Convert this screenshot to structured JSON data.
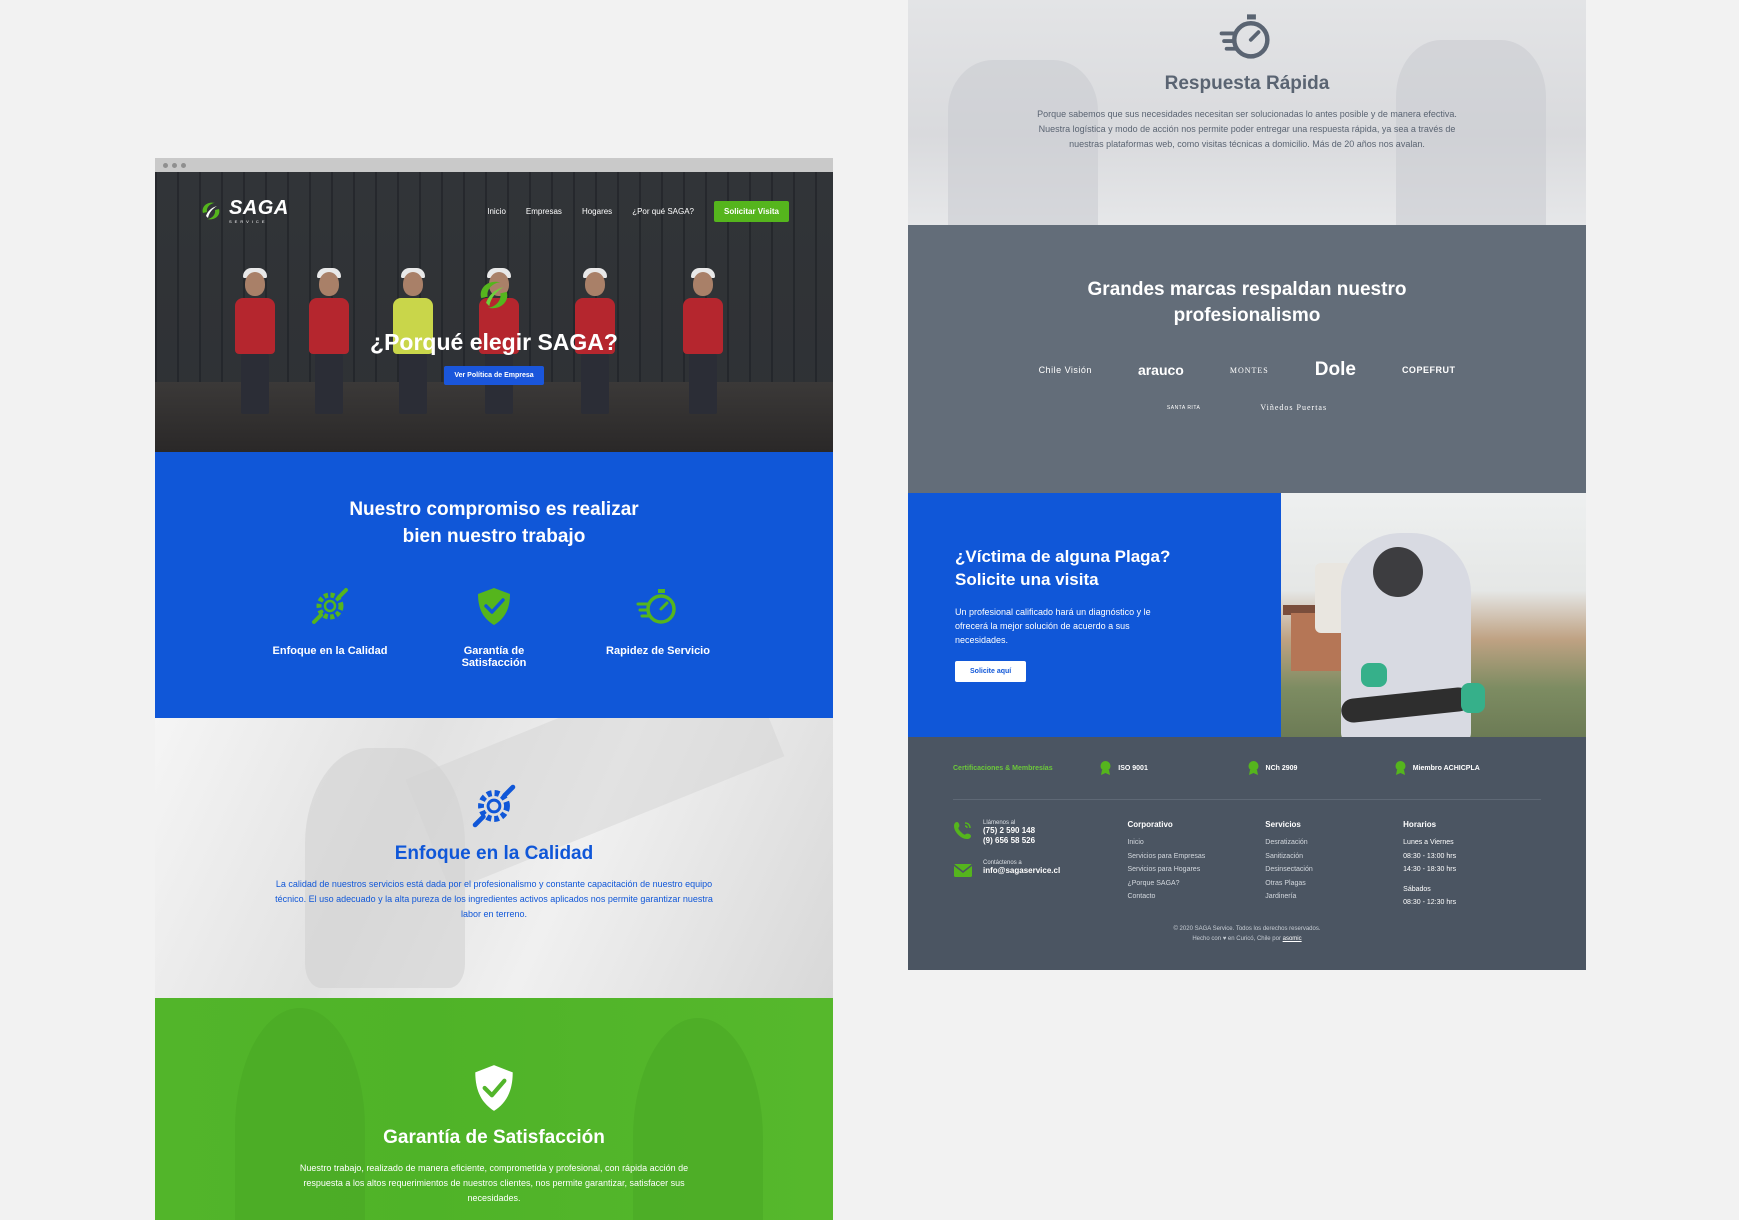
{
  "left": {
    "nav": {
      "logo_text": "SAGA",
      "logo_sub": "SERVICE",
      "links": [
        "Inicio",
        "Empresas",
        "Hogares",
        "¿Por qué SAGA?"
      ],
      "cta": "Solicitar Visita"
    },
    "hero": {
      "title": "¿Porqué elegir SAGA?",
      "button": "Ver Política de Empresa"
    },
    "commitment": {
      "title": "Nuestro compromiso es realizar bien nuestro trabajo",
      "features": [
        "Enfoque en la Calidad",
        "Garantía de Satisfacción",
        "Rapidez de Servicio"
      ]
    },
    "quality": {
      "title": "Enfoque en la Calidad",
      "text": "La calidad de nuestros servicios está dada por el profesionalismo y constante capacitación de nuestro equipo técnico. El uso adecuado y la alta pureza de los ingredientes activos aplicados nos permite garantizar nuestra labor en terreno."
    },
    "satisfaction": {
      "title": "Garantía de Satisfacción",
      "text": "Nuestro trabajo, realizado de manera eficiente, comprometida y profesional, con rápida acción de respuesta a los altos requerimientos de nuestros clientes, nos permite garantizar, satisfacer sus necesidades."
    }
  },
  "right": {
    "rapid": {
      "title": "Respuesta Rápida",
      "text": "Porque sabemos que sus necesidades necesitan ser solucionadas lo antes posible y de manera efectiva. Nuestra logística y modo de acción nos permite poder entregar una respuesta rápida, ya sea a través de nuestras plataformas web, como visitas técnicas a domicilio. Más de 20 años nos avalan."
    },
    "brands": {
      "title": "Grandes marcas respaldan nuestro profesionalismo",
      "row1": [
        "Chile Visión",
        "arauco",
        "MONTES",
        "Dole",
        "COPEFRUT"
      ],
      "row2": [
        "SANTA RITA",
        "Viñedos Puertas"
      ]
    },
    "plaga": {
      "title": "¿Víctima de alguna Plaga? Solicite una visita",
      "text": "Un profesional calificado hará un diagnóstico y le ofrecerá la mejor solución de acuerdo a sus necesidades.",
      "button": "Solicite aquí"
    },
    "footer": {
      "cert_title": "Certificaciones & Membresías",
      "certs": [
        "ISO 9001",
        "NCh 2909",
        "Miembro ACHICPLA"
      ],
      "call_label": "Llámenos al",
      "phone1": "(75) 2 590 148",
      "phone2": "(9) 656 58 526",
      "mail_label": "Contáctenos a",
      "email": "info@sagaservice.cl",
      "corporativo": {
        "title": "Corporativo",
        "items": [
          "Inicio",
          "Servicios para Empresas",
          "Servicios para Hogares",
          "¿Porque SAGA?",
          "Contacto"
        ]
      },
      "servicios": {
        "title": "Servicios",
        "items": [
          "Desratización",
          "Sanitización",
          "Desinsectación",
          "Otras Plagas",
          "Jardinería"
        ]
      },
      "horarios": {
        "title": "Horarios",
        "weekday_label": "Lunes a Viernes",
        "weekday_1": "08:30 - 13:00 hrs",
        "weekday_2": "14:30 - 18:30 hrs",
        "saturday_label": "Sábados",
        "saturday_1": "08:30 - 12:30 hrs"
      },
      "copyright_1": "© 2020 SAGA Service. Todos los derechos reservados.",
      "copyright_2": "Hecho con ♥ en Curicó, Chile por",
      "copyright_link": "asomic"
    }
  },
  "colors": {
    "blue": "#1057d8",
    "green": "#55b51d",
    "slate": "#636d79",
    "footer": "#4b5562"
  }
}
